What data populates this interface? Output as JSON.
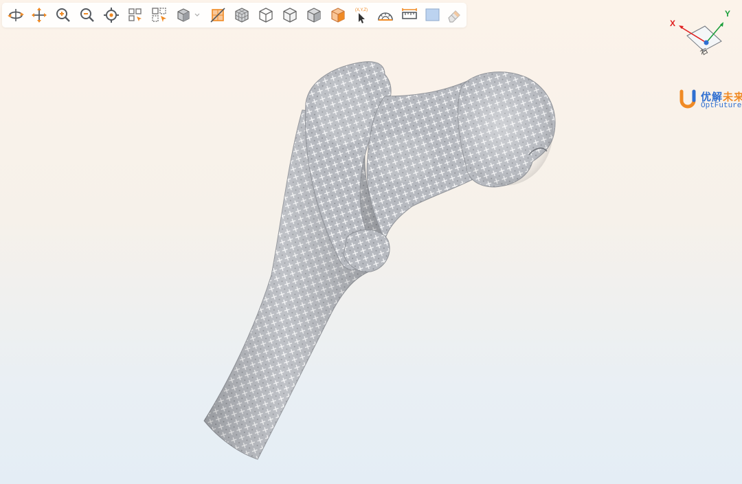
{
  "toolbar": {
    "buttons": [
      {
        "id": "rotate",
        "icon": "rotate-icon"
      },
      {
        "id": "pan",
        "icon": "pan-icon"
      },
      {
        "id": "zoom-in",
        "icon": "zoom-in-icon"
      },
      {
        "id": "zoom-out",
        "icon": "zoom-out-icon"
      },
      {
        "id": "center",
        "icon": "target-icon"
      },
      {
        "id": "select",
        "icon": "select-icon"
      },
      {
        "id": "box-select",
        "icon": "box-select-icon"
      },
      {
        "id": "view-cube",
        "icon": "cube-icon"
      },
      {
        "id": "section",
        "icon": "section-plane-icon"
      },
      {
        "id": "mesh",
        "icon": "mesh-cube-icon"
      },
      {
        "id": "wireframe",
        "icon": "wireframe-cube-icon"
      },
      {
        "id": "edges",
        "icon": "edge-cube-icon"
      },
      {
        "id": "shaded",
        "icon": "shaded-cube-icon"
      },
      {
        "id": "shaded-orange",
        "icon": "colored-cube-icon"
      },
      {
        "id": "pick-point",
        "icon": "pick-point-icon"
      },
      {
        "id": "angle",
        "icon": "protractor-icon"
      },
      {
        "id": "ruler",
        "icon": "ruler-icon"
      },
      {
        "id": "background",
        "icon": "color-swatch-icon"
      },
      {
        "id": "eraser",
        "icon": "eraser-icon"
      }
    ],
    "pick_point_label": "(X,Y,Z)"
  },
  "triad": {
    "x_label": "X",
    "y_label": "Y",
    "face_label": "右",
    "x_color": "#e02020",
    "y_color": "#1a9e3a"
  },
  "brand": {
    "name_cn_blue": "优解",
    "name_cn_orange": "未来",
    "name_en": "OptFuture",
    "blue": "#2f6fd1",
    "orange": "#f08a24"
  },
  "model": {
    "name": "femur-lattice-model",
    "color": "#b9bcc2"
  },
  "colors": {
    "icon_orange": "#f08a24",
    "icon_gray": "#555a60"
  }
}
